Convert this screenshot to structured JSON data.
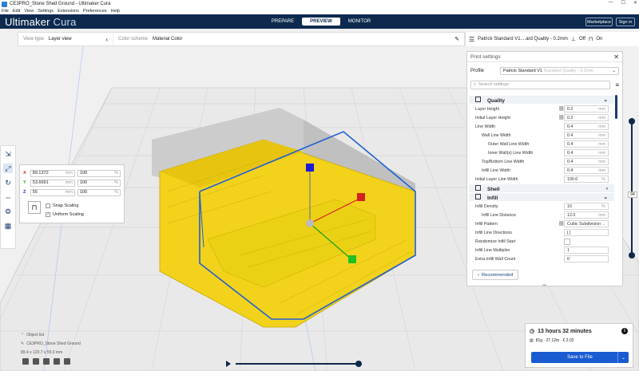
{
  "window": {
    "title": "CE3PRO_Stone Shed Ground - Ultimaker Cura"
  },
  "menu": [
    "File",
    "Edit",
    "View",
    "Settings",
    "Extensions",
    "Preferences",
    "Help"
  ],
  "header": {
    "brand_main": "Ultimaker",
    "brand_sub": "Cura",
    "stages": [
      "PREPARE",
      "PREVIEW",
      "MONITOR"
    ],
    "marketplace": "Marketplace",
    "signin": "Sign in"
  },
  "viewbar": {
    "view_type_label": "View type",
    "view_type_value": "Layer view",
    "color_scheme_label": "Color scheme",
    "color_scheme_value": "Material Color"
  },
  "print_setup": {
    "summary": "Patrick Standard V1....ard Quality - 0.2mm",
    "support": "Off",
    "adhesion": "On"
  },
  "panel": {
    "title": "Print settings",
    "profile_label": "Profile",
    "profile_value": "Patrick Standard V1",
    "profile_hint": "Standard Quality - 0.2mm",
    "search_placeholder": "Search settings",
    "recommended": "Recommended",
    "quality": "Quality",
    "shell": "Shell",
    "infill": "Infill",
    "quality_rows": [
      {
        "name": "Layer Height",
        "value": "0.2",
        "unit": "mm",
        "link": true
      },
      {
        "name": "Initial Layer Height",
        "value": "0.2",
        "unit": "mm",
        "link": true
      },
      {
        "name": "Line Width",
        "value": "0.4",
        "unit": "mm"
      },
      {
        "name": "Wall Line Width",
        "value": "0.4",
        "unit": "mm",
        "indent": 1
      },
      {
        "name": "Outer Wall Line Width",
        "value": "0.4",
        "unit": "mm",
        "indent": 2
      },
      {
        "name": "Inner Wall(s) Line Width",
        "value": "0.4",
        "unit": "mm",
        "indent": 2
      },
      {
        "name": "Top/Bottom Line Width",
        "value": "0.4",
        "unit": "mm",
        "indent": 1
      },
      {
        "name": "Infill Line Width",
        "value": "0.4",
        "unit": "mm",
        "indent": 1
      },
      {
        "name": "Initial Layer Line Width",
        "value": "100.0",
        "unit": "%"
      }
    ],
    "infill_rows": [
      {
        "name": "Infill Density",
        "value": "10",
        "unit": "%"
      },
      {
        "name": "Infill Line Distance",
        "value": "12.0",
        "unit": "mm",
        "indent": 1
      },
      {
        "name": "Infill Pattern",
        "value": "Cubic Subdivision",
        "unit": "⌄",
        "link": true
      },
      {
        "name": "Infill Line Directions",
        "value": "[ ]",
        "unit": ""
      },
      {
        "name": "Randomize Infill Start",
        "value": "",
        "unit": "",
        "checkbox": true
      },
      {
        "name": "Infill Line Multiplier",
        "value": "1",
        "unit": ""
      },
      {
        "name": "Extra Infill Wall Count",
        "value": "0",
        "unit": ""
      }
    ]
  },
  "scale": {
    "x_mm": "89.1372",
    "y_mm": "53.6691",
    "z_mm": "55",
    "x_pct": "100",
    "y_pct": "100",
    "z_pct": "100",
    "mm": "mm",
    "pct": "%",
    "snap": "Snap Scaling",
    "uniform": "Uniform Scaling"
  },
  "layer": {
    "current": "94"
  },
  "object": {
    "list_label": "Object list",
    "name": "CE3PRO_Stone Shed Ground",
    "dims": "89.4 x 120.7 x 55.0 mm"
  },
  "estimate": {
    "time": "13 hours 32 minutes",
    "material": "81g · 27.12m · € 2.02",
    "save": "Save to File"
  }
}
